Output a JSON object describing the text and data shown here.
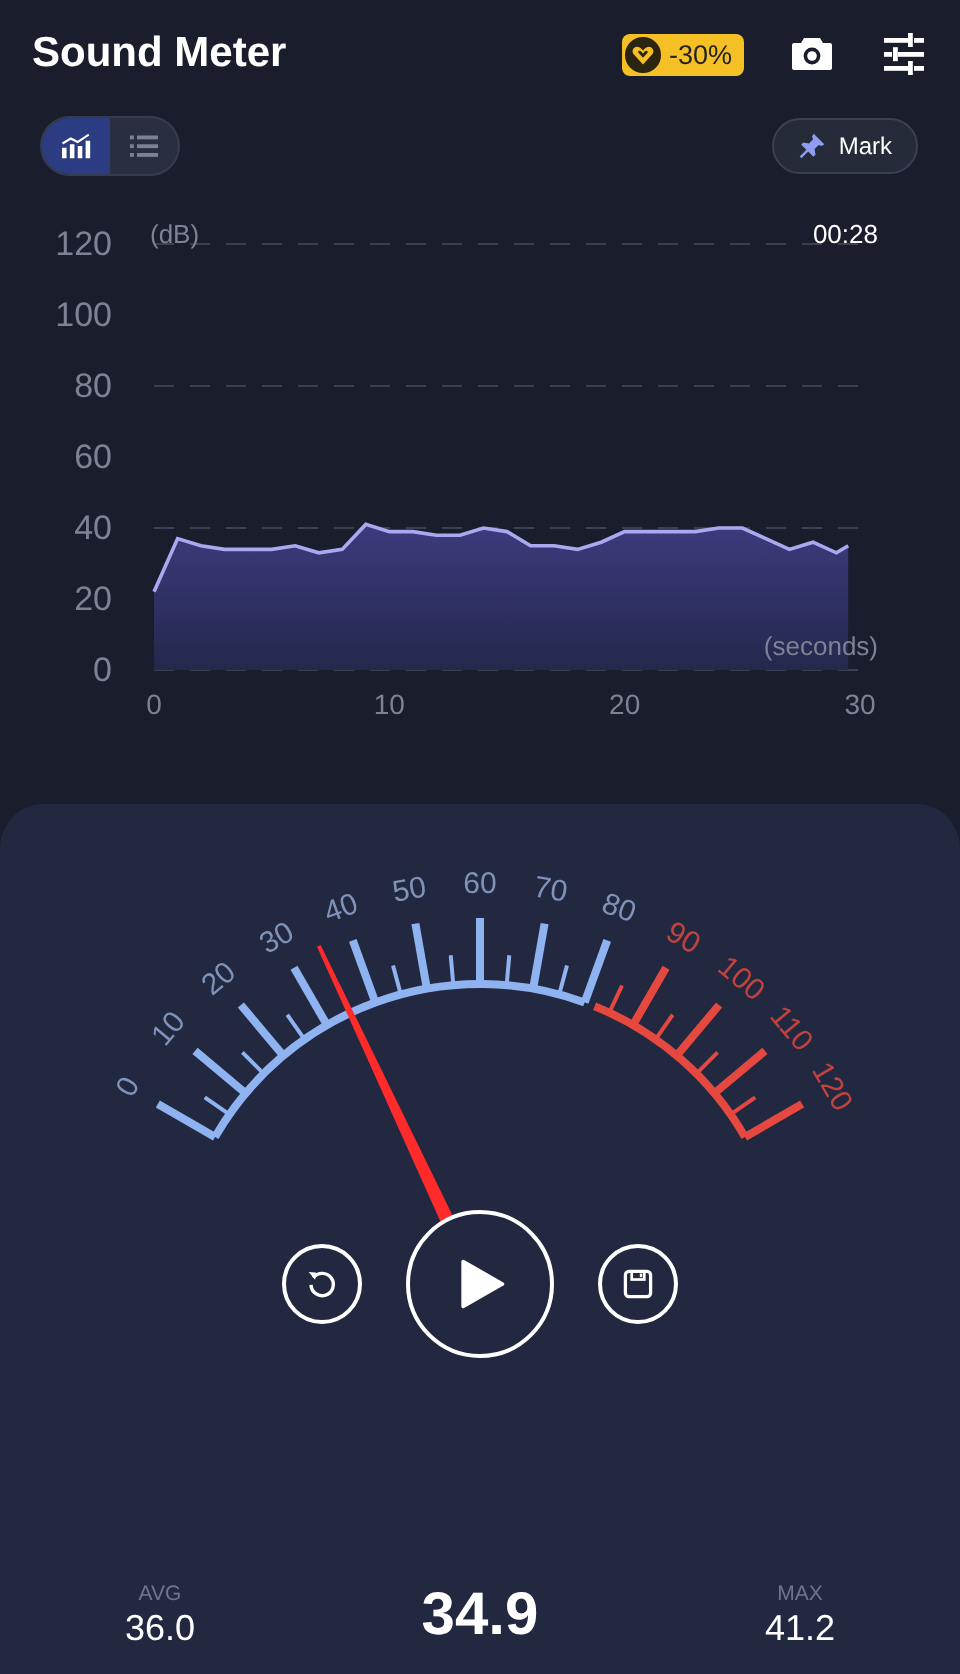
{
  "app_bar": {
    "title": "Sound Meter",
    "discount_badge": "-30%"
  },
  "view_tabs": [
    {
      "kind": "chart",
      "selected": true
    },
    {
      "kind": "list",
      "selected": false
    }
  ],
  "mark_button": "Mark",
  "chart": {
    "elapsed": "00:28",
    "chart_data": {
      "type": "area",
      "ylabel": "(dB)",
      "xlabel": "(seconds)",
      "x": [
        0,
        1,
        2,
        3,
        4,
        5,
        6,
        7,
        8,
        9,
        10,
        11,
        12,
        13,
        14,
        15,
        16,
        17,
        18,
        19,
        20,
        21,
        22,
        23,
        24,
        25,
        26,
        27,
        28,
        29,
        29.5
      ],
      "series": [
        {
          "color": "#a9a8f0",
          "values": [
            22,
            37,
            35,
            34,
            34,
            34,
            35,
            33,
            34,
            41,
            39,
            39,
            38,
            38,
            40,
            39,
            35,
            35,
            34,
            36,
            39,
            39,
            39,
            39,
            40,
            40,
            37,
            34,
            36,
            33,
            35
          ]
        }
      ],
      "xlim": [
        0,
        30
      ],
      "ylim": [
        0,
        120
      ],
      "xticks": [
        0,
        10,
        20,
        30
      ],
      "yticks": [
        0,
        20,
        40,
        60,
        80,
        100,
        120
      ]
    }
  },
  "gauge": {
    "scale": [
      {
        "label": "0",
        "color": "#7f93b8"
      },
      {
        "label": "10",
        "color": "#7f93b8"
      },
      {
        "label": "20",
        "color": "#7f93b8"
      },
      {
        "label": "30",
        "color": "#7f93b8"
      },
      {
        "label": "40",
        "color": "#7f93b8"
      },
      {
        "label": "50",
        "color": "#7f93b8"
      },
      {
        "label": "60",
        "color": "#7f93b8"
      },
      {
        "label": "70",
        "color": "#7f93b8"
      },
      {
        "label": "80",
        "color": "#7f93b8"
      },
      {
        "label": "90",
        "color": "#c0433d"
      },
      {
        "label": "100",
        "color": "#c0433d"
      },
      {
        "label": "110",
        "color": "#c0433d"
      },
      {
        "label": "120",
        "color": "#c0433d"
      }
    ]
  },
  "stats": {
    "avg_label": "AVG",
    "avg": "36.0",
    "current": "34.9",
    "max_label": "MAX",
    "max": "41.2"
  }
}
